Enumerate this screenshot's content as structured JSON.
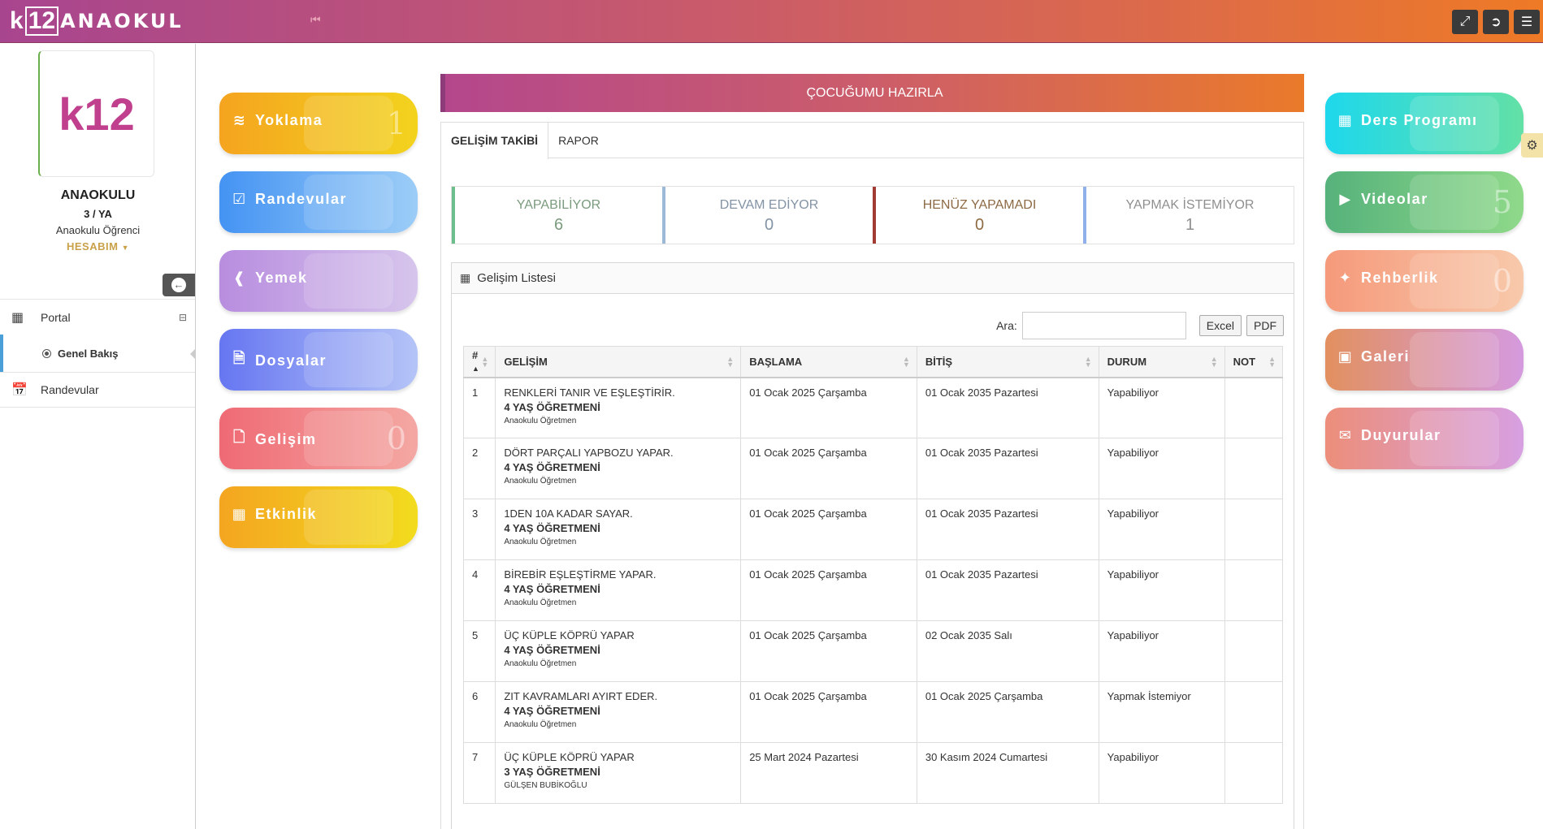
{
  "header": {
    "logo_text": "k12ANAOKUL",
    "logo_k": "k",
    "logo_12": "12",
    "logo_brand": "ANAOKUL"
  },
  "sidebar": {
    "logo_text": "k12",
    "school": "ANAOKULU",
    "class": "3 / YA",
    "role": "Anaokulu Öğrenci",
    "account": "HESABIM",
    "items": [
      {
        "label": "Portal"
      },
      {
        "label": "Genel Bakış"
      },
      {
        "label": "Randevular"
      }
    ]
  },
  "tiles_left": [
    {
      "label": "Yoklama",
      "count": "1",
      "color": "#f5a623"
    },
    {
      "label": "Randevular",
      "count": "",
      "color": "#4a9af5"
    },
    {
      "label": "Yemek",
      "count": "",
      "color": "#b98fe0"
    },
    {
      "label": "Dosyalar",
      "count": "",
      "color": "#6b7cf2"
    },
    {
      "label": "Gelişim",
      "count": "0",
      "color": "#ee6f77"
    },
    {
      "label": "Etkinlik",
      "count": "",
      "color": "#f4b21f"
    }
  ],
  "tiles_right": [
    {
      "label": "Ders Programı",
      "count": "",
      "color": "#1fd3e8"
    },
    {
      "label": "Videolar",
      "count": "5",
      "color": "#5fb87a"
    },
    {
      "label": "Rehberlik",
      "count": "0",
      "color": "#f49a7a"
    },
    {
      "label": "Galeri",
      "count": "",
      "color": "#e08f6f"
    },
    {
      "label": "Duyurular",
      "count": "",
      "color": "#e889a8"
    }
  ],
  "main": {
    "banner": "ÇOCUĞUMU HAZIRLA",
    "tabs": [
      "GELİŞİM TAKİBİ",
      "RAPOR"
    ],
    "stats": [
      {
        "label": "YAPABİLİYOR",
        "value": "6"
      },
      {
        "label": "DEVAM EDİYOR",
        "value": "0"
      },
      {
        "label": "HENÜZ YAPAMADI",
        "value": "0"
      },
      {
        "label": "YAPMAK İSTEMİYOR",
        "value": "1"
      }
    ],
    "list_title": "Gelişim Listesi",
    "search_label": "Ara:",
    "search_value": "",
    "excel_label": "Excel",
    "pdf_label": "PDF",
    "columns": [
      "#",
      "GELİŞİM",
      "BAŞLAMA",
      "BİTİŞ",
      "DURUM",
      "NOT"
    ],
    "rows": [
      {
        "no": "1",
        "title": "RENKLERİ TANIR VE EŞLEŞTİRİR.",
        "teacher": "4 YAŞ ÖĞRETMENİ",
        "by": "Anaokulu Öğretmen",
        "start": "01 Ocak 2025 Çarşamba",
        "end": "01 Ocak 2035 Pazartesi",
        "status": "Yapabiliyor",
        "note": ""
      },
      {
        "no": "2",
        "title": "DÖRT PARÇALI YAPBOZU YAPAR.",
        "teacher": "4 YAŞ ÖĞRETMENİ",
        "by": "Anaokulu Öğretmen",
        "start": "01 Ocak 2025 Çarşamba",
        "end": "01 Ocak 2035 Pazartesi",
        "status": "Yapabiliyor",
        "note": ""
      },
      {
        "no": "3",
        "title": "1DEN 10A KADAR SAYAR.",
        "teacher": "4 YAŞ ÖĞRETMENİ",
        "by": "Anaokulu Öğretmen",
        "start": "01 Ocak 2025 Çarşamba",
        "end": "01 Ocak 2035 Pazartesi",
        "status": "Yapabiliyor",
        "note": ""
      },
      {
        "no": "4",
        "title": "BİREBİR EŞLEŞTİRME YAPAR.",
        "teacher": "4 YAŞ ÖĞRETMENİ",
        "by": "Anaokulu Öğretmen",
        "start": "01 Ocak 2025 Çarşamba",
        "end": "01 Ocak 2035 Pazartesi",
        "status": "Yapabiliyor",
        "note": ""
      },
      {
        "no": "5",
        "title": "ÜÇ KÜPLE KÖPRÜ YAPAR",
        "teacher": "4 YAŞ ÖĞRETMENİ",
        "by": "Anaokulu Öğretmen",
        "start": "01 Ocak 2025 Çarşamba",
        "end": "02 Ocak 2035 Salı",
        "status": "Yapabiliyor",
        "note": ""
      },
      {
        "no": "6",
        "title": "ZIT KAVRAMLARI AYIRT EDER.",
        "teacher": "4 YAŞ ÖĞRETMENİ",
        "by": "Anaokulu Öğretmen",
        "start": "01 Ocak 2025 Çarşamba",
        "end": "01 Ocak 2025 Çarşamba",
        "status": "Yapmak İstemiyor",
        "note": ""
      },
      {
        "no": "7",
        "title": "ÜÇ KÜPLE KÖPRÜ YAPAR",
        "teacher": "3 YAŞ ÖĞRETMENİ",
        "by": "GÜLŞEN BUBİKOĞLU",
        "start": "25 Mart 2024 Pazartesi",
        "end": "30 Kasım 2024 Cumartesi",
        "status": "Yapabiliyor",
        "note": ""
      }
    ]
  }
}
